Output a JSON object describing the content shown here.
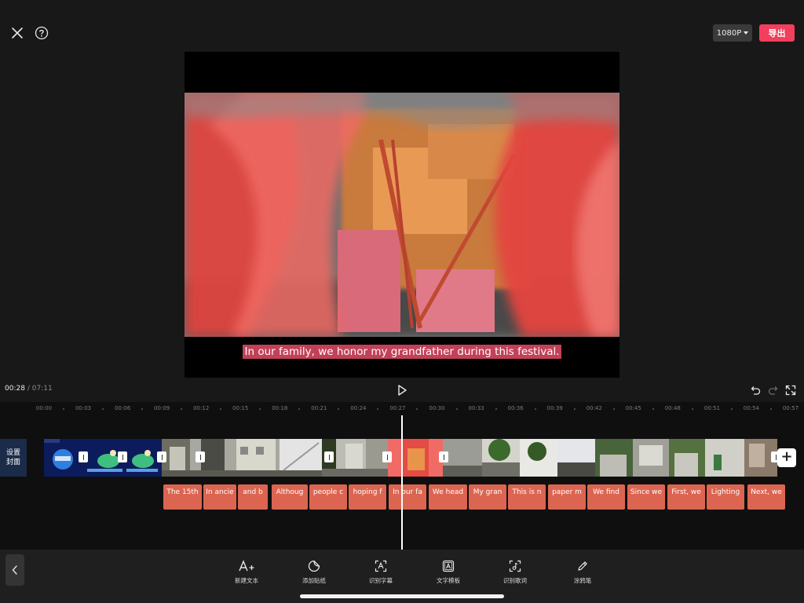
{
  "header": {
    "resolution_label": "1080P",
    "export_label": "导出"
  },
  "preview": {
    "subtitle": "In our family, we honor my grandfather during this festival."
  },
  "playback": {
    "current_time": "00:28",
    "separator": "/",
    "total_time": "07:11"
  },
  "timeline": {
    "ruler_ticks": [
      "00:00",
      "00:03",
      "00:06",
      "00:09",
      "00:12",
      "00:15",
      "00:18",
      "00:21",
      "00:24",
      "00:27",
      "00:30",
      "00:33",
      "00:36",
      "00:39",
      "00:42",
      "00:45",
      "00:48",
      "00:51",
      "00:54",
      "00:57"
    ],
    "cover_label": "设置封面",
    "add_clip_label": "+",
    "subtitle_clips": [
      "The 15th",
      "In ancie",
      "and b",
      "Althoug",
      "people c",
      "hoping f",
      "In our fa",
      "We head",
      "My gran",
      "This is n",
      "paper m",
      "We find",
      "Since we",
      "First, we",
      "Lighting",
      "Next, we"
    ]
  },
  "toolbar": {
    "items": [
      {
        "label": "新建文本",
        "icon": "add-text-icon"
      },
      {
        "label": "添加贴纸",
        "icon": "sticker-icon"
      },
      {
        "label": "识别字幕",
        "icon": "recognize-subtitle-icon"
      },
      {
        "label": "文字模板",
        "icon": "text-template-icon"
      },
      {
        "label": "识别歌词",
        "icon": "recognize-lyrics-icon"
      },
      {
        "label": "涂鸦笔",
        "icon": "brush-icon"
      }
    ]
  },
  "colors": {
    "accent": "#f23f5d",
    "subtitle_clip": "#dc6551",
    "background": "#181818"
  }
}
